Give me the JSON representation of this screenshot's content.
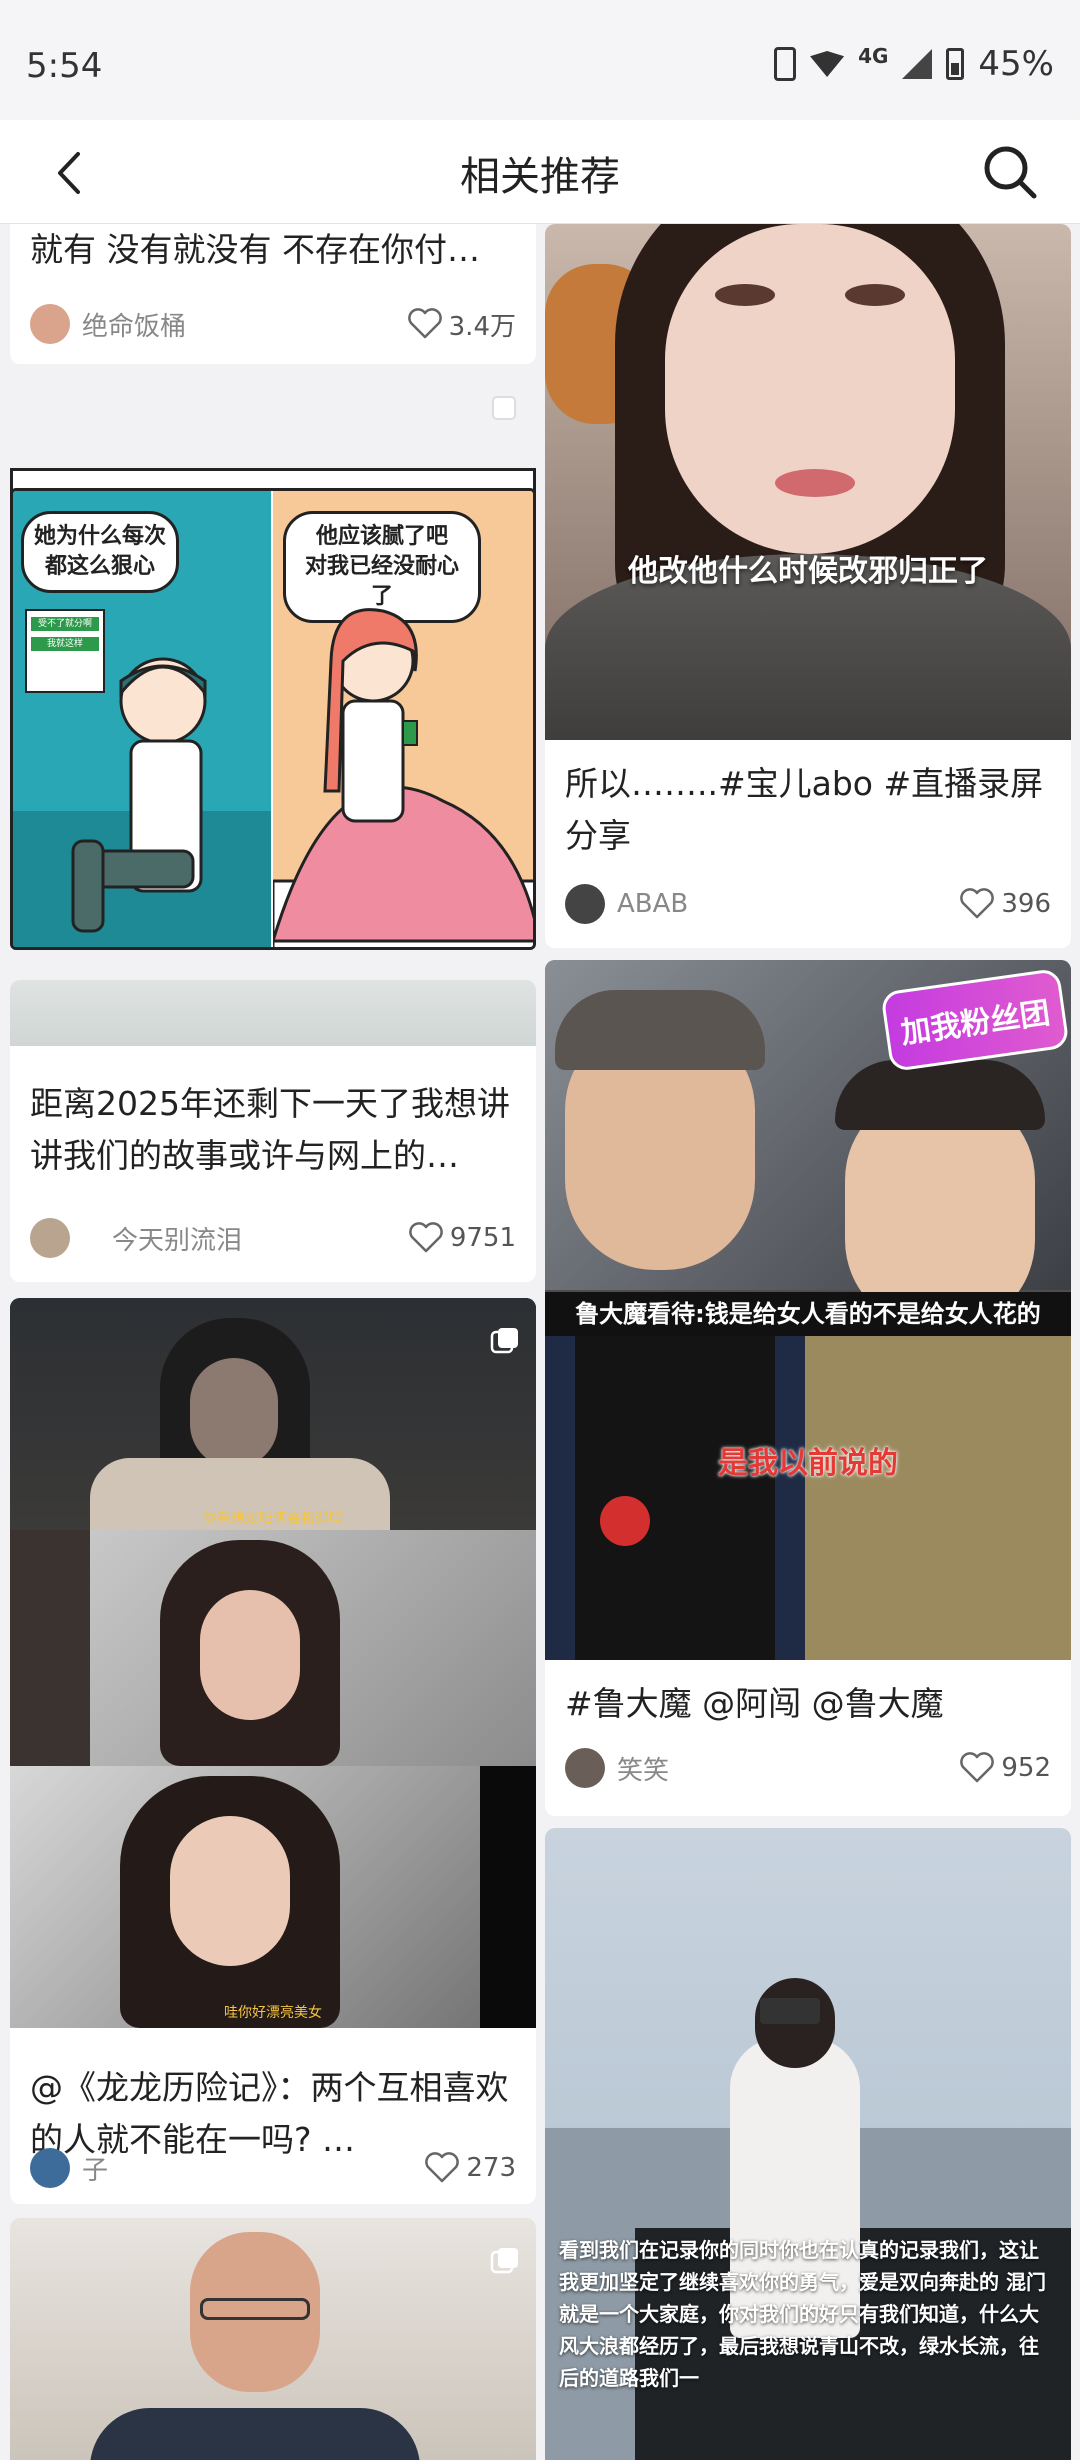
{
  "status_bar": {
    "time": "5:54",
    "network": "4G",
    "battery": "45%"
  },
  "header": {
    "title": "相关推荐",
    "back_icon": "chevron-left-icon",
    "search_icon": "search-icon"
  },
  "feed": {
    "left": [
      {
        "caption": "就有 没有就没有 不存在你付…",
        "user": "绝命饭桶",
        "likes": "3.4万"
      },
      {
        "comic_text_1": "她为什么每次\n都这么狠心",
        "comic_text_2": "他应该腻了吧\n对我已经没耐心了",
        "comic_msg_1": "受不了就分啊",
        "comic_msg_2": "我就这样"
      },
      {
        "caption": "距离2025年还剩下一天了我想讲讲我们的故事或许与网上的…",
        "user": "今天别流泪",
        "likes": "9751"
      },
      {
        "subtitle_1": "你有想过咱俩会相遇吗",
        "subtitle_2": "哇你好漂亮美女",
        "caption": "@《龙龙历险记》：两个互相喜欢的人就不能在一吗? …",
        "user": "子",
        "likes": "273"
      },
      {}
    ],
    "right": [
      {
        "overlay": "他改他什么时候改邪归正了",
        "caption": "所以……..#宝儿abo  #直播录屏分享",
        "user": "ABAB",
        "likes": "396"
      },
      {
        "badge": "加我粉丝团",
        "banner": "鲁大魔看待:钱是给女人看的不是给女人花的",
        "subtitle": "是我以前说的",
        "caption": "#鲁大魔 @阿闯 @鲁大魔",
        "user": "笑笑",
        "likes": "952"
      },
      {
        "overlay_long": "看到我们在记录你的同时你也在认真的记录我们，这让我更加坚定了继续喜欢你的勇气，爱是双向奔赴的 混门就是一个大家庭，你对我们的好只有我们知道，什么大风大浪都经历了，最后我想说青山不改，绿水长流，往后的道路我们一"
      }
    ]
  },
  "colors": {
    "accent": "#222222",
    "background": "#f2f2f4",
    "comic_teal": "#2aa7b4",
    "comic_peach": "#f8c998"
  }
}
